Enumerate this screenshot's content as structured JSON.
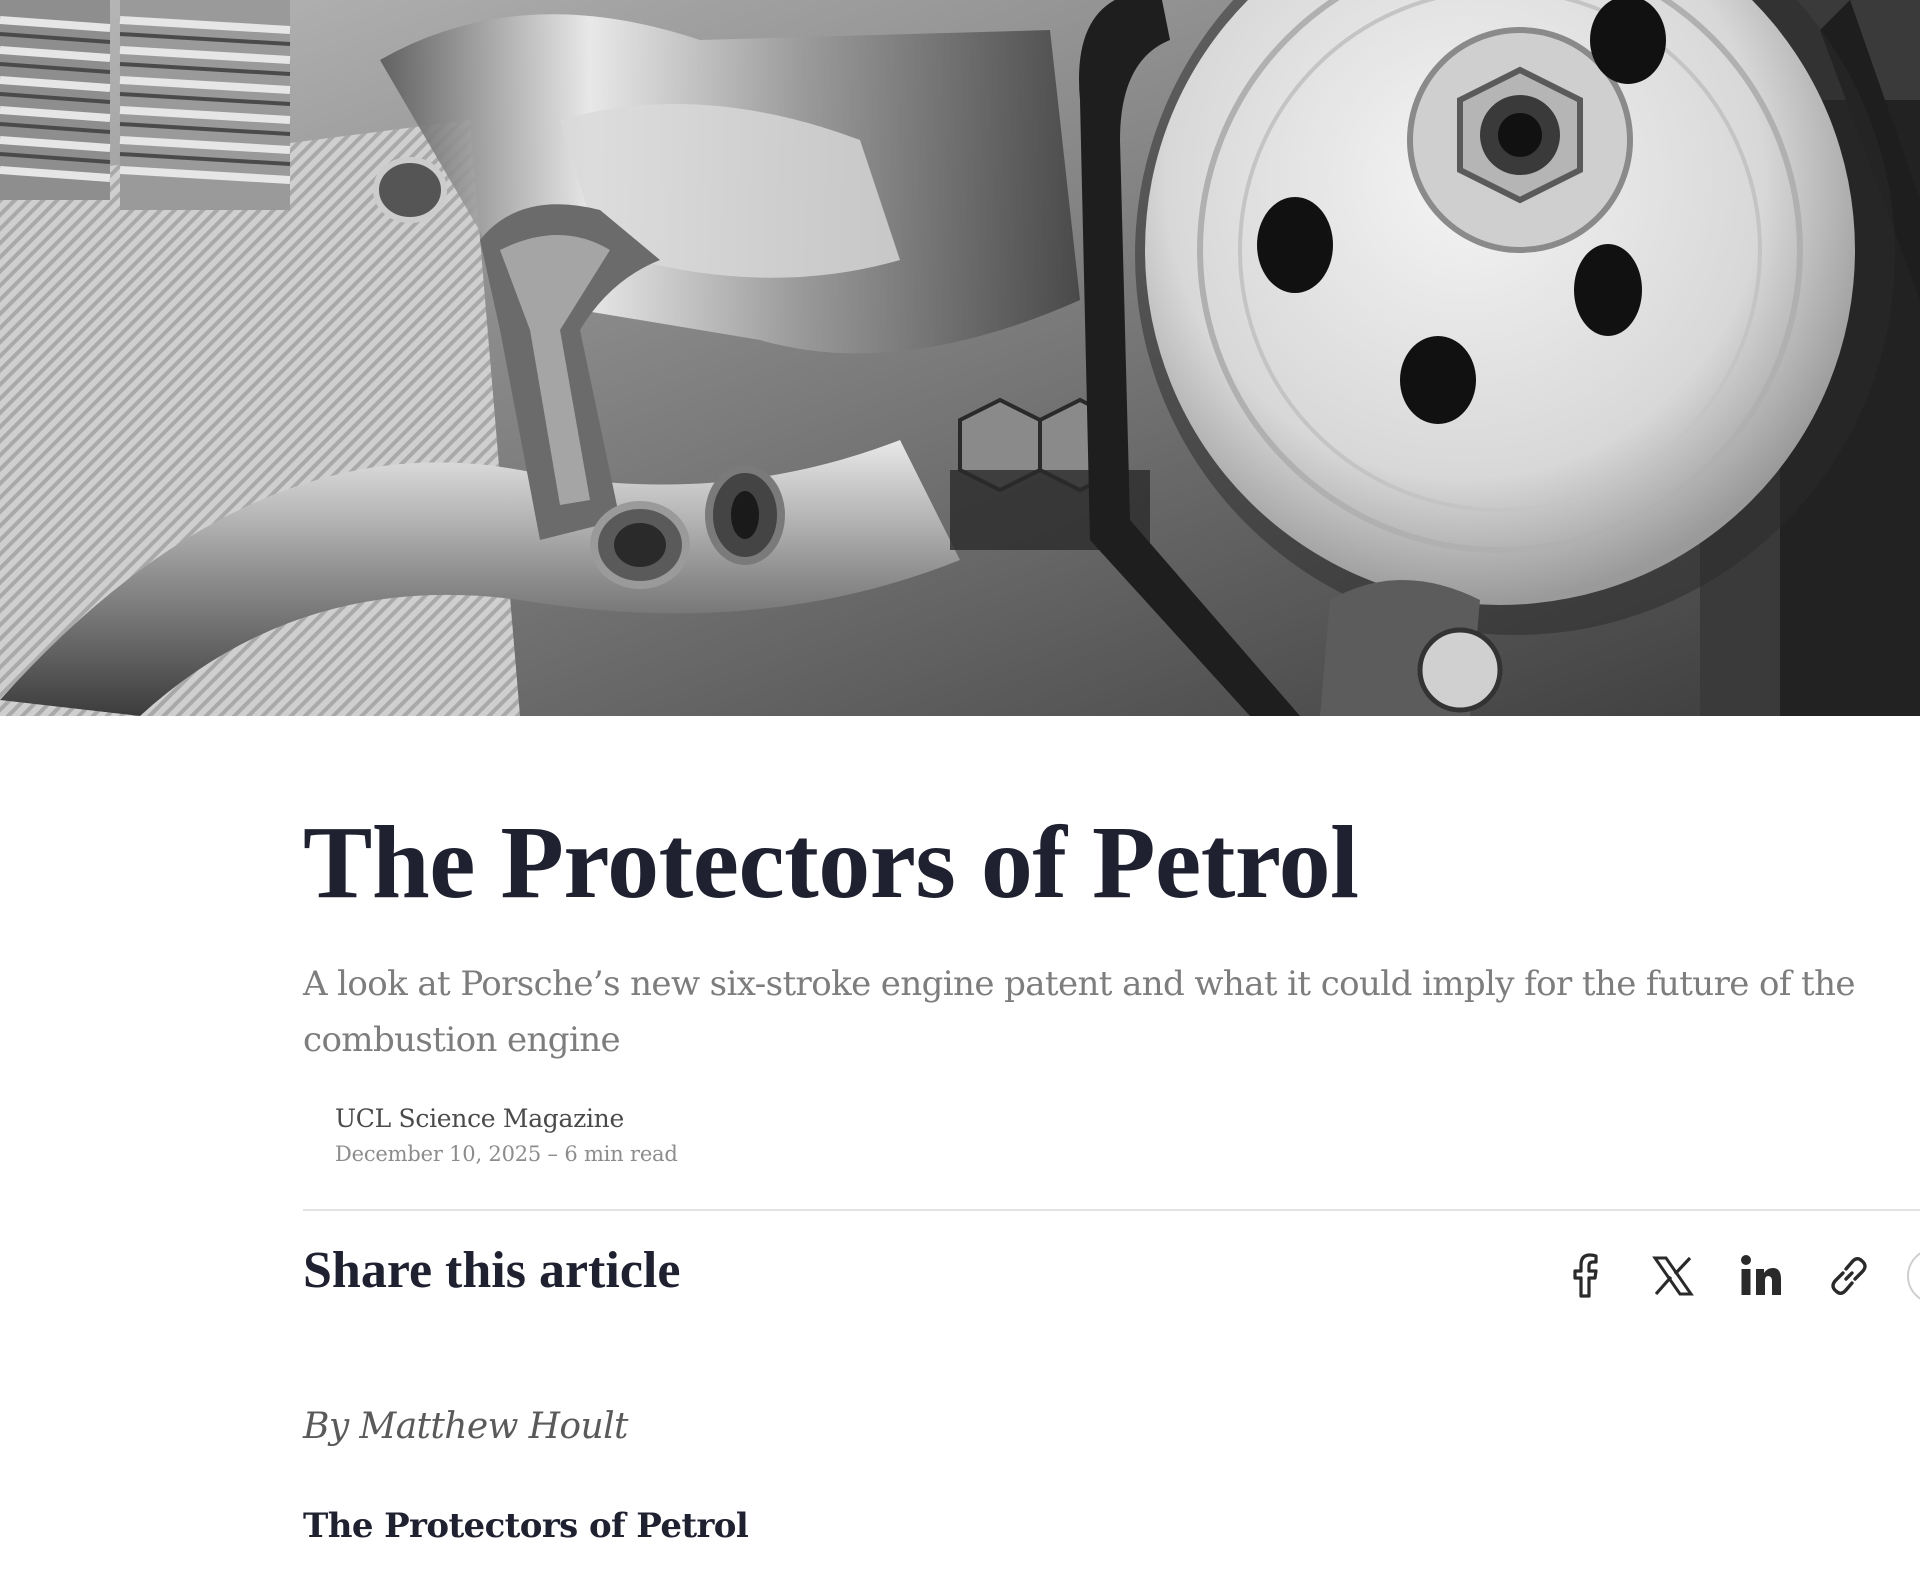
{
  "hero": {
    "image_description": "hero-image"
  },
  "article": {
    "title": "The Protectors of Petrol",
    "subtitle": "A look at Porsche’s new six-stroke engine patent and what it could imply for the future of the combustion engine",
    "publisher": "UCL Science Magazine",
    "date_readtime": "December 10, 2025 – 6 min read",
    "share_heading": "Share this article",
    "byline": "By Matthew Hoult",
    "section_heading": "The Protectors of Petrol"
  },
  "share": {
    "icons": [
      "facebook-icon",
      "x-icon",
      "linkedin-icon",
      "link-icon",
      "more-icon"
    ]
  },
  "colors": {
    "title": "#1f2130",
    "subtitle": "#7d7d7d",
    "meta": "#8c8c8c",
    "icon": "#2a2a2a",
    "divider": "#e3e3e3"
  }
}
